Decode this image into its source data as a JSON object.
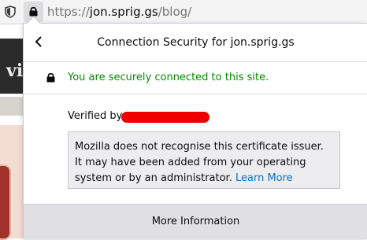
{
  "browser": {
    "url_prefix": "https://",
    "url_host": "jon.sprig.gs",
    "url_path": "/blog/",
    "tracking_icon": "shield-icon",
    "lock_icon": "lock-icon"
  },
  "background_page": {
    "banner_text_fragment": "s vi"
  },
  "panel": {
    "title": "Connection Security for jon.sprig.gs",
    "back_icon": "back-arrow-icon",
    "secure_message": "You are securely connected to this site.",
    "verified_by_label": "Verified by:",
    "verified_by_value_redacted": true,
    "notice_text": "Mozilla does not recognise this certificate issuer. It may have been added from your operating system or by an administrator.",
    "learn_more_label": "Learn More",
    "more_info_label": "More Information"
  },
  "colors": {
    "secure_green": "#058b00",
    "link_blue": "#0a70c9",
    "redaction_red": "#ee0000",
    "notice_background": "#ededf0",
    "footer_button_background": "#e0e0e2"
  }
}
